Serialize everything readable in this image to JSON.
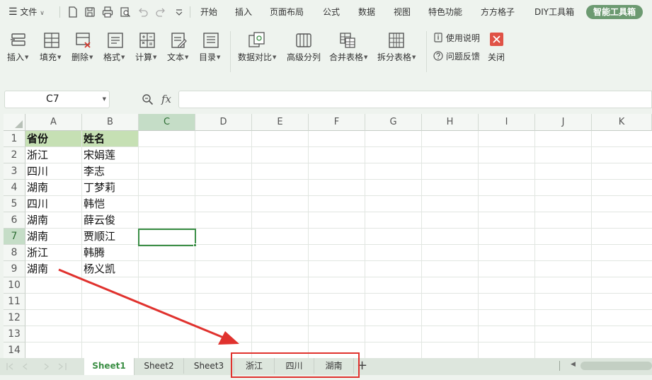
{
  "menubar": {
    "file_label": "文件",
    "tabs": [
      "开始",
      "插入",
      "页面布局",
      "公式",
      "数据",
      "视图",
      "特色功能",
      "方方格子",
      "DIY工具箱"
    ],
    "active_tab": "智能工具箱"
  },
  "ribbon": {
    "buttons": [
      "插入",
      "填充",
      "删除",
      "格式",
      "计算",
      "文本",
      "目录",
      "数据对比",
      "高级分列",
      "合并表格",
      "拆分表格"
    ],
    "help_label": "使用说明",
    "feedback_label": "问题反馈",
    "close_label": "关闭"
  },
  "formula_bar": {
    "name_box": "C7",
    "fx_label": "fx",
    "formula": ""
  },
  "sheet": {
    "columns": [
      "A",
      "B",
      "C",
      "D",
      "E",
      "F",
      "G",
      "H",
      "I",
      "J",
      "K"
    ],
    "rows": [
      "1",
      "2",
      "3",
      "4",
      "5",
      "6",
      "7",
      "8",
      "9",
      "10",
      "11",
      "12",
      "13",
      "14"
    ],
    "selected_column": "C",
    "selected_row": "7",
    "header": [
      "省份",
      "姓名"
    ],
    "data": [
      [
        "浙江",
        "宋娟莲"
      ],
      [
        "四川",
        "李志"
      ],
      [
        "湖南",
        "丁梦莉"
      ],
      [
        "四川",
        "韩恺"
      ],
      [
        "湖南",
        "薛云俊"
      ],
      [
        "湖南",
        "贾顺江"
      ],
      [
        "浙江",
        "韩腾"
      ],
      [
        "湖南",
        "杨义凯"
      ]
    ]
  },
  "sheet_tabs": {
    "tabs": [
      "Sheet1",
      "Sheet2",
      "Sheet3",
      "浙江",
      "四川",
      "湖南"
    ],
    "active": "Sheet1",
    "add_label": "+"
  },
  "colors": {
    "accent": "#3b8f45",
    "header_fill": "#c6e0b4",
    "annotation": "#e0322e"
  }
}
